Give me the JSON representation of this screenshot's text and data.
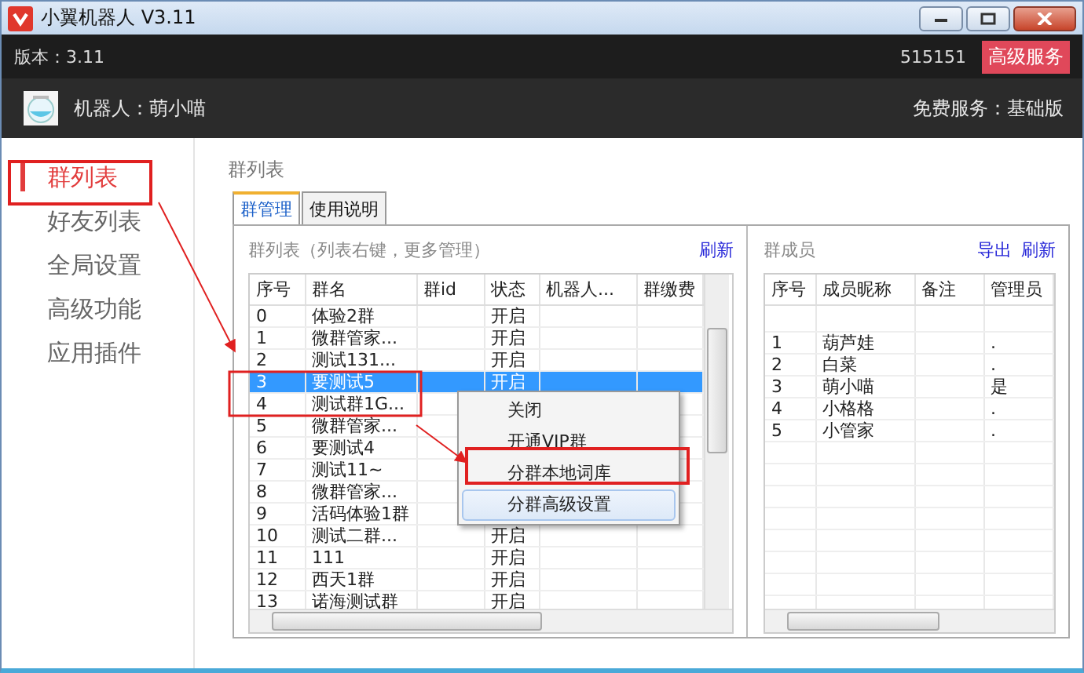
{
  "window": {
    "title": "小翼机器人 V3.11"
  },
  "header": {
    "version": "版本：3.11",
    "account": "515151",
    "service_button": "高级服务"
  },
  "robot_bar": {
    "robot": "机器人：萌小喵",
    "plan": "免费服务：基础版"
  },
  "sidebar": {
    "items": [
      {
        "label": "群列表",
        "selected": true
      },
      {
        "label": "好友列表",
        "selected": false
      },
      {
        "label": "全局设置",
        "selected": false
      },
      {
        "label": "高级功能",
        "selected": false
      },
      {
        "label": "应用插件",
        "selected": false
      }
    ]
  },
  "page_title": "群列表",
  "tabs": [
    {
      "label": "群管理",
      "selected": true
    },
    {
      "label": "使用说明",
      "selected": false
    }
  ],
  "group_list": {
    "title": "群列表（列表右键，更多管理）",
    "refresh": "刷新",
    "columns": [
      "序号",
      "群名",
      "群id",
      "状态",
      "机器人...",
      "群缴费"
    ],
    "rows": [
      {
        "no": "0",
        "name": "体验2群",
        "status": "开启",
        "selected": false
      },
      {
        "no": "1",
        "name": "微群管家...",
        "status": "开启",
        "selected": false
      },
      {
        "no": "2",
        "name": "测试131...",
        "status": "开启",
        "selected": false
      },
      {
        "no": "3",
        "name": "要测试5",
        "status": "开启",
        "selected": true
      },
      {
        "no": "4",
        "name": "测试群1G...",
        "selected": false
      },
      {
        "no": "5",
        "name": "微群管家...",
        "selected": false
      },
      {
        "no": "6",
        "name": "要测试4",
        "selected": false
      },
      {
        "no": "7",
        "name": "测试11~",
        "selected": false
      },
      {
        "no": "8",
        "name": "微群管家...",
        "selected": false
      },
      {
        "no": "9",
        "name": "活码体验1群",
        "selected": false
      },
      {
        "no": "10",
        "name": "测试二群...",
        "status": "开启",
        "selected": false
      },
      {
        "no": "11",
        "name": "111",
        "status": "开启",
        "selected": false
      },
      {
        "no": "12",
        "name": "西天1群",
        "status": "开启",
        "selected": false
      },
      {
        "no": "13",
        "name": "诺海测试群",
        "status": "开启",
        "selected": false
      }
    ]
  },
  "context_menu": {
    "items": [
      {
        "label": "关闭",
        "highlighted": false
      },
      {
        "label": "开通VIP群",
        "highlighted": false
      },
      {
        "label": "分群本地词库",
        "highlighted": false
      },
      {
        "label": "分群高级设置",
        "highlighted": true
      }
    ]
  },
  "members": {
    "title": "群成员",
    "export": "导出",
    "refresh": "刷新",
    "columns": [
      "序号",
      "成员昵称",
      "备注",
      "管理员"
    ],
    "rows": [
      {
        "no": "1",
        "nickname": "葫芦娃",
        "admin": "."
      },
      {
        "no": "2",
        "nickname": "白菜",
        "admin": "."
      },
      {
        "no": "3",
        "nickname": "萌小喵",
        "admin": "是"
      },
      {
        "no": "4",
        "nickname": "小格格",
        "admin": "."
      },
      {
        "no": "5",
        "nickname": "小管家",
        "admin": "."
      }
    ]
  }
}
